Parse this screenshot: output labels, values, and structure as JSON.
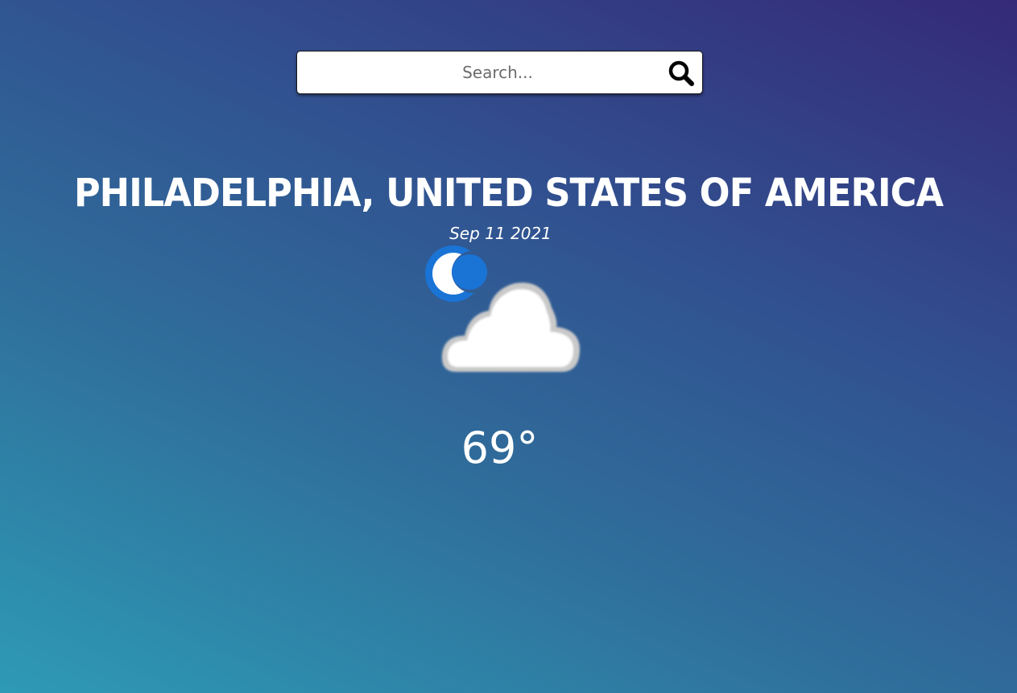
{
  "search": {
    "placeholder": "Search...",
    "button_icon": "search-icon"
  },
  "location": {
    "title": "PHILADELPHIA, UNITED STATES OF AMERICA",
    "date": "Sep 11 2021"
  },
  "weather": {
    "icon": "moon-cloud-icon",
    "temperature": "69°"
  },
  "colors": {
    "gradient_start": "#2e9ab5",
    "gradient_end": "#352a78",
    "moon": "#1a74d6",
    "cloud": "#ffffff"
  }
}
